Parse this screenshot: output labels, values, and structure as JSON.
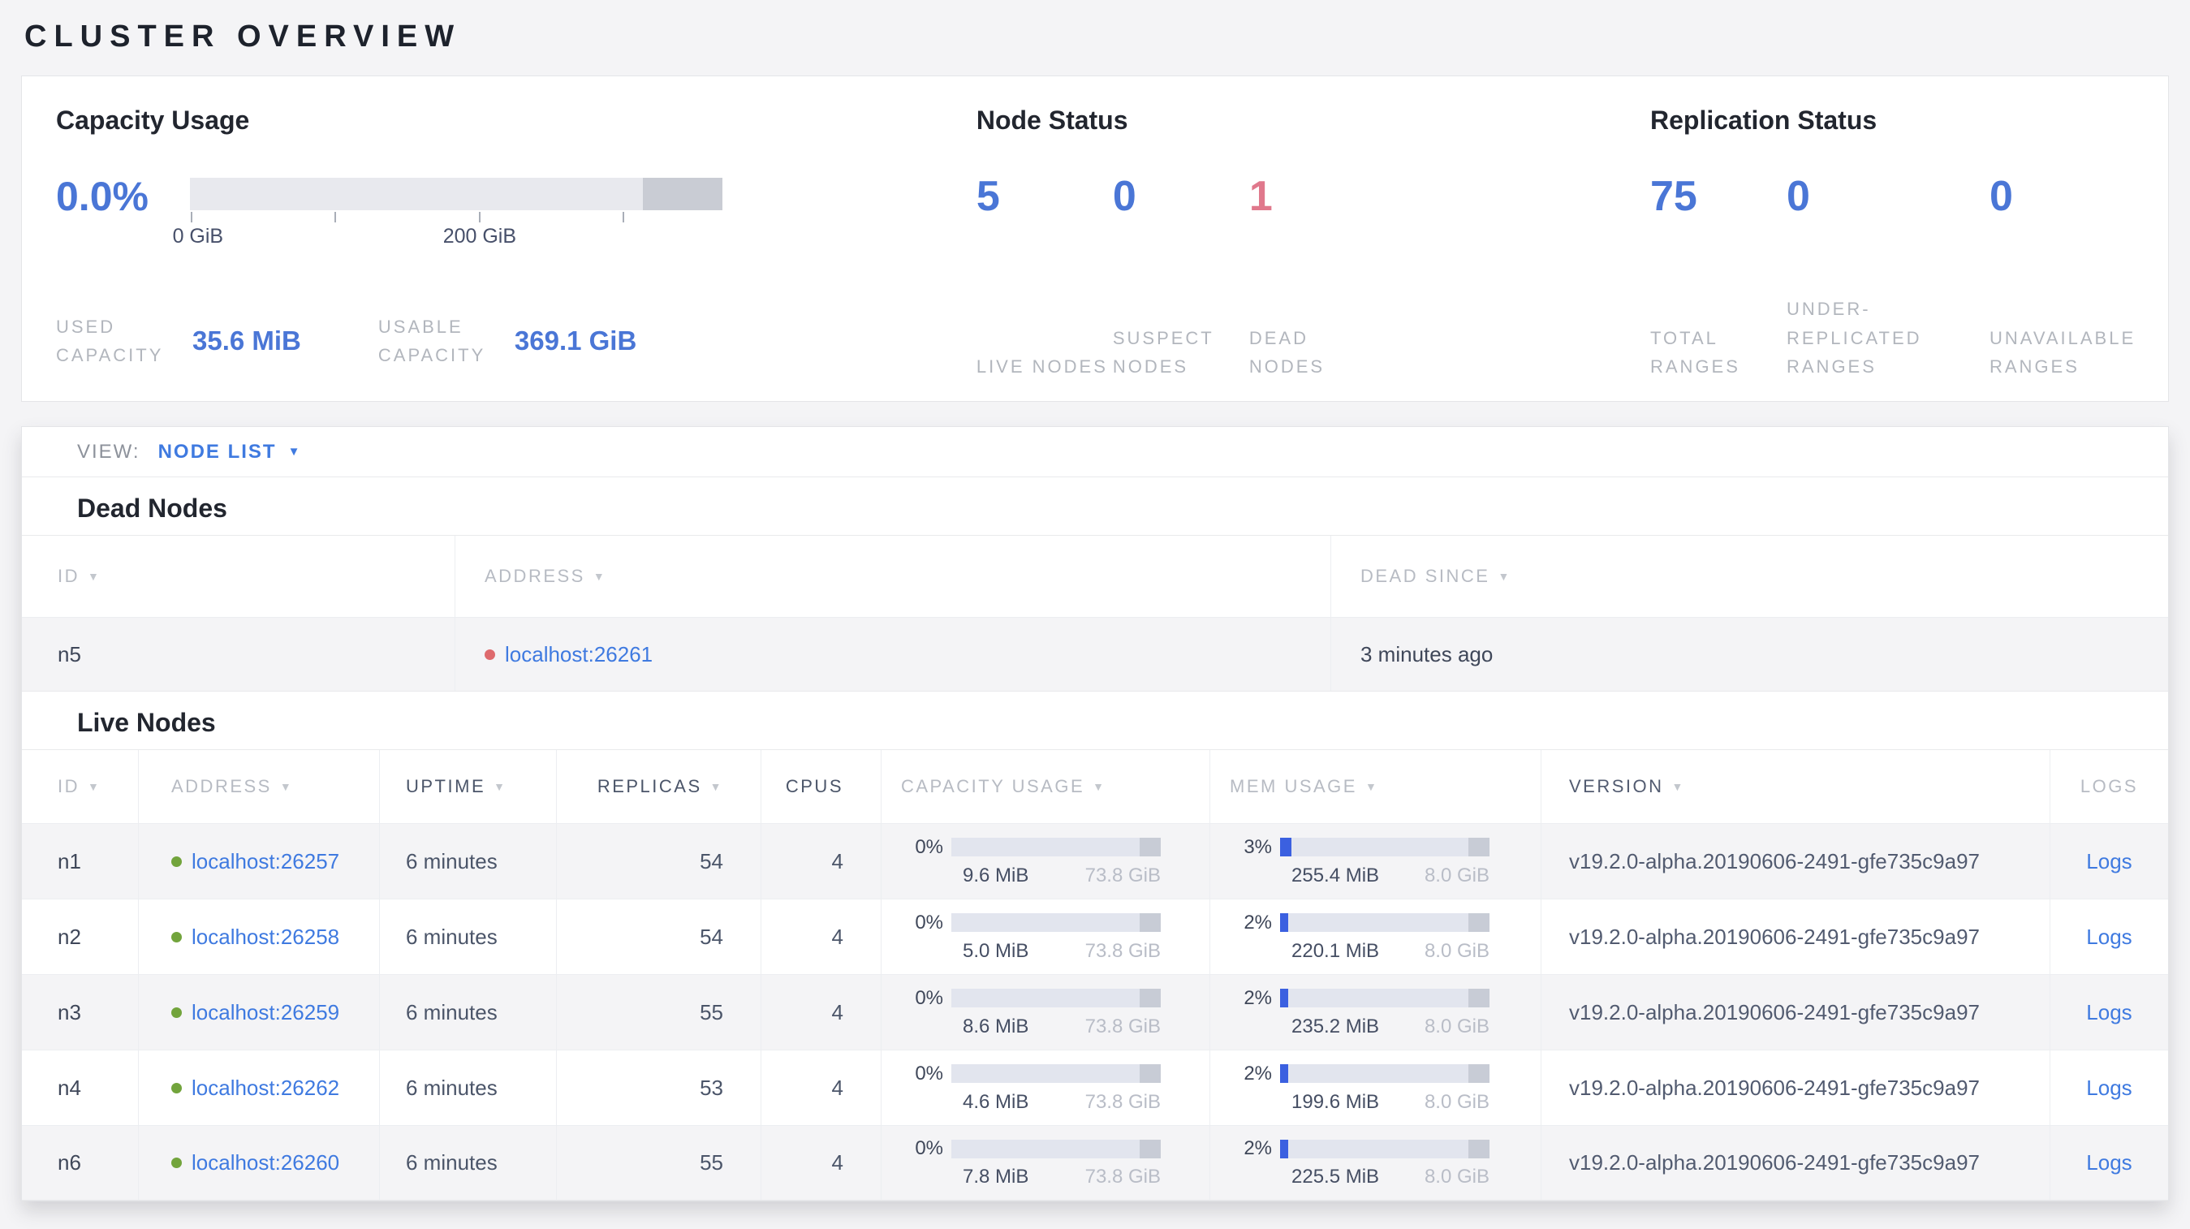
{
  "colors": {
    "accent_blue": "#4a76d6",
    "danger_pink": "#e0788c",
    "link_blue": "#3f7ae0",
    "mem_fill_blue": "#3b60e0",
    "live_dot_green": "#72a43c",
    "dead_dot_red": "#de6a6d"
  },
  "icons": {
    "sort_arrow": "▼",
    "dropdown_arrow": "▼"
  },
  "page": {
    "title": "CLUSTER OVERVIEW"
  },
  "summary": {
    "capacity": {
      "title": "Capacity Usage",
      "percent": "0.0%",
      "axis_ticks": [
        "0 GiB",
        "200 GiB"
      ],
      "metrics": [
        {
          "label": "USED CAPACITY",
          "value": "35.6 MiB"
        },
        {
          "label": "USABLE CAPACITY",
          "value": "369.1 GiB"
        }
      ]
    },
    "node_status": {
      "title": "Node Status",
      "stats": [
        {
          "value": "5",
          "label": "LIVE NODES"
        },
        {
          "value": "0",
          "label": "SUSPECT NODES"
        },
        {
          "value": "1",
          "label": "DEAD NODES"
        }
      ]
    },
    "replication": {
      "title": "Replication Status",
      "stats": [
        {
          "value": "75",
          "label": "TOTAL RANGES"
        },
        {
          "value": "0",
          "label": "UNDER-REPLICATED RANGES"
        },
        {
          "value": "0",
          "label": "UNAVAILABLE RANGES"
        }
      ]
    }
  },
  "view_bar": {
    "label": "VIEW:",
    "value": "NODE LIST"
  },
  "dead_nodes": {
    "heading": "Dead Nodes",
    "columns": [
      {
        "label": "ID"
      },
      {
        "label": "ADDRESS"
      },
      {
        "label": "DEAD SINCE"
      }
    ],
    "rows": [
      {
        "id": "n5",
        "address": "localhost:26261",
        "dead_since": "3 minutes ago"
      }
    ]
  },
  "live_nodes": {
    "heading": "Live Nodes",
    "columns": [
      {
        "label": "ID"
      },
      {
        "label": "ADDRESS"
      },
      {
        "label": "UPTIME"
      },
      {
        "label": "REPLICAS"
      },
      {
        "label": "CPUS"
      },
      {
        "label": "CAPACITY USAGE"
      },
      {
        "label": "MEM USAGE"
      },
      {
        "label": "VERSION"
      },
      {
        "label": "LOGS"
      }
    ],
    "logs_label": "Logs",
    "rows": [
      {
        "id": "n1",
        "address": "localhost:26257",
        "uptime": "6 minutes",
        "replicas": "54",
        "cpus": "4",
        "cap_pct": "0%",
        "cap_used": "9.6 MiB",
        "cap_total": "73.8 GiB",
        "mem_pct": "3%",
        "mem_used": "255.4 MiB",
        "mem_total": "8.0 GiB",
        "version": "v19.2.0-alpha.20190606-2491-gfe735c9a97"
      },
      {
        "id": "n2",
        "address": "localhost:26258",
        "uptime": "6 minutes",
        "replicas": "54",
        "cpus": "4",
        "cap_pct": "0%",
        "cap_used": "5.0 MiB",
        "cap_total": "73.8 GiB",
        "mem_pct": "2%",
        "mem_used": "220.1 MiB",
        "mem_total": "8.0 GiB",
        "version": "v19.2.0-alpha.20190606-2491-gfe735c9a97"
      },
      {
        "id": "n3",
        "address": "localhost:26259",
        "uptime": "6 minutes",
        "replicas": "55",
        "cpus": "4",
        "cap_pct": "0%",
        "cap_used": "8.6 MiB",
        "cap_total": "73.8 GiB",
        "mem_pct": "2%",
        "mem_used": "235.2 MiB",
        "mem_total": "8.0 GiB",
        "version": "v19.2.0-alpha.20190606-2491-gfe735c9a97"
      },
      {
        "id": "n4",
        "address": "localhost:26262",
        "uptime": "6 minutes",
        "replicas": "53",
        "cpus": "4",
        "cap_pct": "0%",
        "cap_used": "4.6 MiB",
        "cap_total": "73.8 GiB",
        "mem_pct": "2%",
        "mem_used": "199.6 MiB",
        "mem_total": "8.0 GiB",
        "version": "v19.2.0-alpha.20190606-2491-gfe735c9a97"
      },
      {
        "id": "n6",
        "address": "localhost:26260",
        "uptime": "6 minutes",
        "replicas": "55",
        "cpus": "4",
        "cap_pct": "0%",
        "cap_used": "7.8 MiB",
        "cap_total": "73.8 GiB",
        "mem_pct": "2%",
        "mem_used": "225.5 MiB",
        "mem_total": "8.0 GiB",
        "version": "v19.2.0-alpha.20190606-2491-gfe735c9a97"
      }
    ]
  }
}
